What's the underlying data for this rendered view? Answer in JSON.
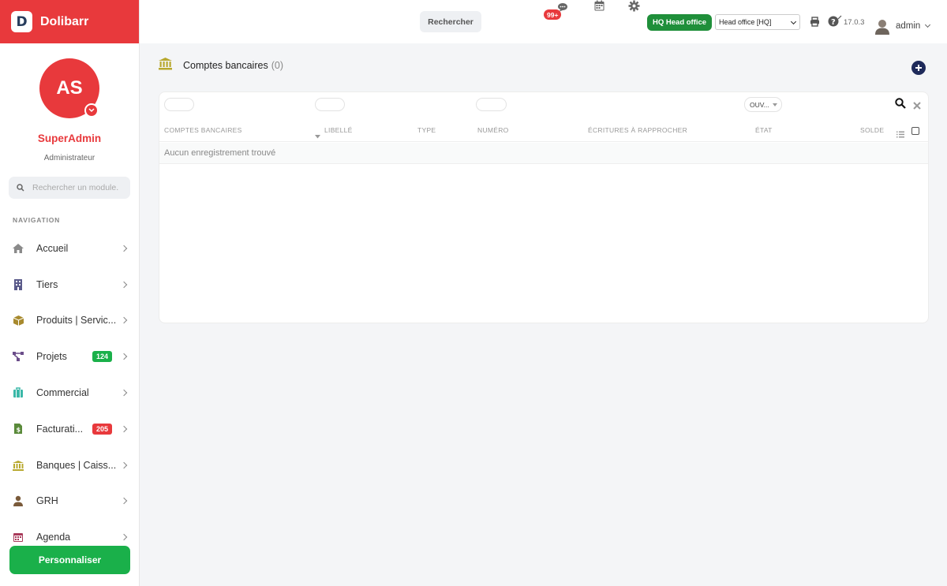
{
  "brand": {
    "logo_letter": "D",
    "name": "Dolibarr"
  },
  "user": {
    "initials": "AS",
    "name": "SuperAdmin",
    "role": "Administrateur"
  },
  "module_search": {
    "placeholder": "Rechercher un module."
  },
  "nav": {
    "title": "NAVIGATION",
    "items": [
      {
        "label": "Accueil",
        "icon": "home-icon"
      },
      {
        "label": "Tiers",
        "icon": "building-icon"
      },
      {
        "label": "Produits | Servic...",
        "icon": "box-icon"
      },
      {
        "label": "Projets",
        "icon": "project-icon",
        "badge": "124",
        "badge_color": "#1ab04a"
      },
      {
        "label": "Commercial",
        "icon": "suitcase-icon"
      },
      {
        "label": "Facturati...",
        "icon": "invoice-icon",
        "badge": "205",
        "badge_color": "#e8393c"
      },
      {
        "label": "Banques | Caiss...",
        "icon": "bank-icon"
      },
      {
        "label": "GRH",
        "icon": "user-tie-icon"
      },
      {
        "label": "Agenda",
        "icon": "calendar-icon"
      }
    ]
  },
  "customize_label": "Personnaliser",
  "topbar": {
    "search_label": "Rechercher",
    "notif_badge": "99+",
    "entity_badge": "HQ Head office",
    "entity_select": "Head office [HQ]",
    "version": "17.0.3",
    "user_label": "admin"
  },
  "page": {
    "title": "Comptes bancaires",
    "count": "(0)",
    "filter_status": "OUV...",
    "columns": [
      "COMPTES BANCAIRES",
      "LIBELLÉ",
      "TYPE",
      "NUMÉRO",
      "ÉCRITURES À RAPPROCHER",
      "ÉTAT",
      "SOLDE"
    ],
    "empty_message": "Aucun enregistrement trouvé"
  },
  "colors": {
    "brand": "#e8393c",
    "success": "#1ab04a",
    "entity": "#1f8f3a",
    "accent": "#1e2a5a"
  }
}
